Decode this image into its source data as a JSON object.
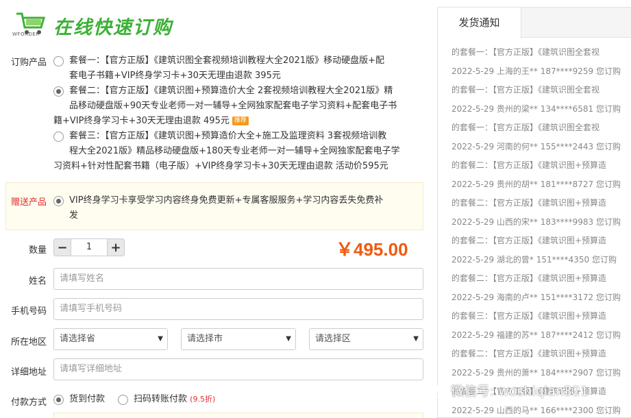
{
  "header": {
    "logo_text": "WFORDER",
    "title": "在线快速订购"
  },
  "product": {
    "label": "订购产品",
    "packages": [
      {
        "lines": [
          "套餐一：【官方正版】《建筑识图全套视频培训教程大全2021版》移动硬盘版+配",
          "套电子书籍+VIP终身学习卡+30天无理由退款 395元"
        ],
        "checked": false
      },
      {
        "lines": [
          "套餐二：【官方正版】《建筑识图+预算造价大全 2套视频培训教程大全2021版》精",
          "品移动硬盘版+90天专业老师一对一辅导+全网独家配套电子学习资料+配套电子书",
          "籍+VIP终身学习卡+30天无理由退款 495元"
        ],
        "badge": "推荐",
        "checked": true
      },
      {
        "lines": [
          "套餐三：【官方正版】《建筑识图+预算造价大全+施工及监理资料 3套视频培训教",
          "程大全2021版》精品移动硬盘版+180天专业老师一对一辅导+全网独家配套电子学",
          "习资料+针对性配套书籍（电子版）+VIP终身学习卡+30天无理由退款 活动价595元"
        ],
        "checked": false
      }
    ]
  },
  "gift": {
    "label": "赠送产品",
    "lines": [
      "VIP终身学习卡享受学习内容终身免费更新+专属客服服务+学习内容丢失免费补",
      "发"
    ]
  },
  "quantity": {
    "label": "数量",
    "minus": "−",
    "plus": "+",
    "value": "1"
  },
  "price": "￥495.00",
  "fields": {
    "name": {
      "label": "姓名",
      "placeholder": "请填写姓名"
    },
    "phone": {
      "label": "手机号码",
      "placeholder": "请填写手机号码"
    },
    "region": {
      "label": "所在地区",
      "province": "请选择省",
      "city": "请选择市",
      "district": "请选择区"
    },
    "address": {
      "label": "详细地址",
      "placeholder": "请填写详细地址"
    }
  },
  "payment": {
    "label": "付款方式",
    "cod": "货到付款",
    "scan": "扫码转账付款",
    "scan_note": "(9.5折)"
  },
  "sidebar": {
    "tab": "发货通知",
    "lines": [
      "的套餐一：【官方正版】《建筑识图全套视",
      "2022-5-29 上海的王** 187****9259 您订购",
      "的套餐一：【官方正版】《建筑识图全套视",
      "2022-5-29 贵州的梁** 134****6581 您订购",
      "的套餐一：【官方正版】《建筑识图全套视",
      "2022-5-29 河南的何** 155****2443 您订购",
      "的套餐二：【官方正版】《建筑识图+预算造",
      "2022-5-29 贵州的胡** 181****8727 您订购",
      "的套餐二：【官方正版】《建筑识图+预算造",
      "2022-5-29 山西的宋** 183****9983 您订购",
      "的套餐二：【官方正版】《建筑识图+预算造",
      "2022-5-29 湖北的曾* 151****4350 您订购",
      "的套餐二：【官方正版】《建筑识图+预算造",
      "2022-5-29 海南的卢** 151****3172 您订购",
      "的套餐三：【官方正版】《建筑识图+预算造",
      "2022-5-29 福建的苏** 187****2412 您订购",
      "的套餐二：【官方正版】《建筑识图+预算造",
      "2022-5-29 贵州的萧** 184****2907 您订购",
      "的套餐二：【官方正版】《建筑识图+预算造",
      "2022-5-29 山西的马** 166****2300 您订购"
    ]
  },
  "watermark": "微信号: woshiqian321",
  "colors": {
    "title_green": "#3cb135",
    "price_orange": "#f05a0e",
    "gift_red": "#e02c2c",
    "badge_orange": "#f39a1d"
  }
}
